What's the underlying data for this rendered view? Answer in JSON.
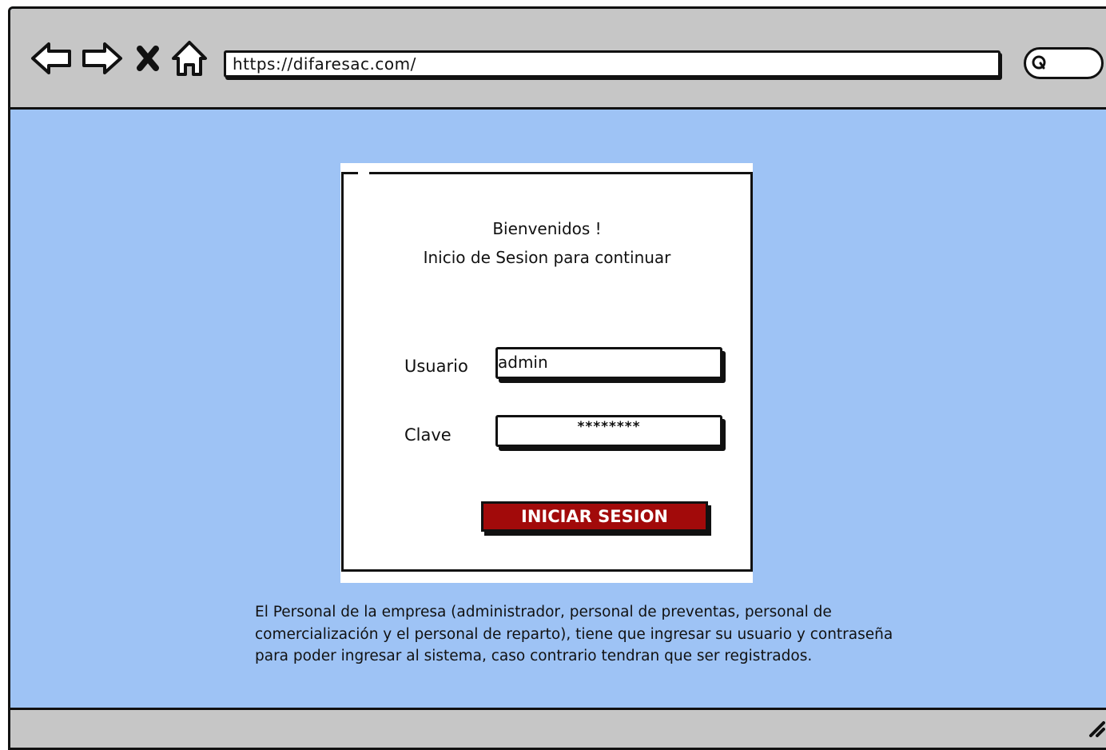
{
  "browser": {
    "url": "https://difaresac.com/",
    "icons": [
      "back-arrow-icon",
      "forward-arrow-icon",
      "close-x-icon",
      "home-icon",
      "search-icon",
      "resize-grip-icon"
    ]
  },
  "login": {
    "welcome": "Bienvenidos !",
    "subtitle": "Inicio de Sesion para continuar",
    "user_label": "Usuario",
    "user_value": "admin",
    "password_label": "Clave",
    "password_value": "********",
    "submit_label": "INICIAR SESION"
  },
  "footer_note": "El Personal de la empresa (administrador, personal de preventas, personal de comercialización y el personal de reparto), tiene que ingresar su usuario y contraseña para poder ingresar al sistema, caso contrario tendran que ser registrados.",
  "colors": {
    "page_background": "#9ec3f5",
    "chrome": "#c6c6c6",
    "button": "#a20a0a"
  }
}
